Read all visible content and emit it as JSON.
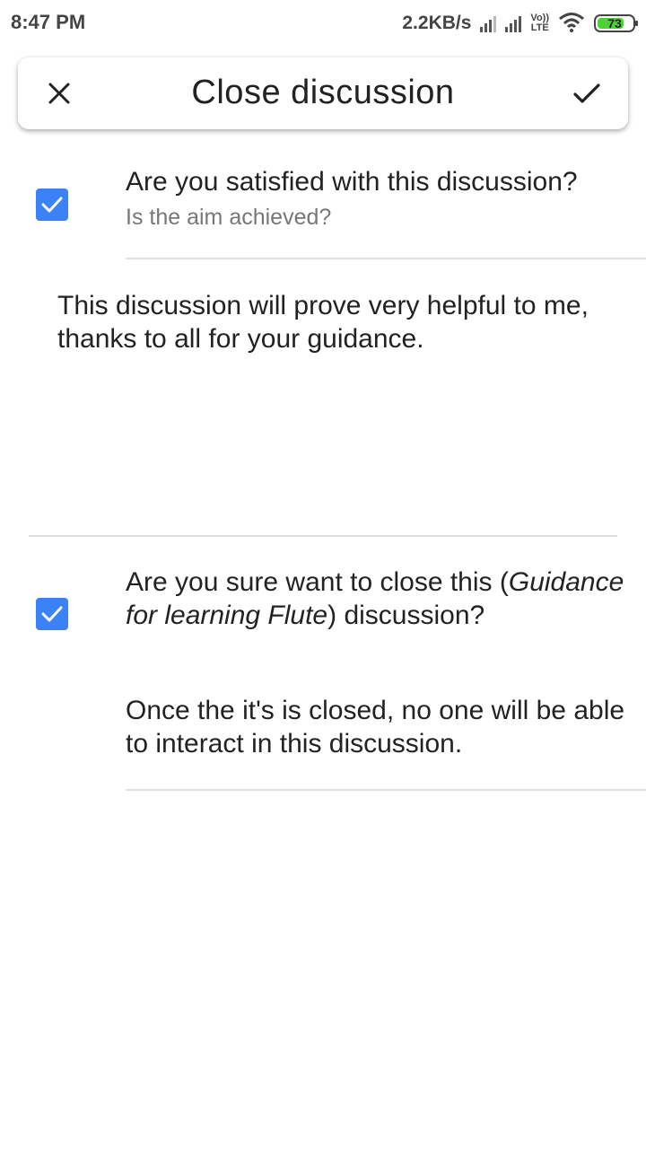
{
  "status_bar": {
    "time": "8:47 PM",
    "network_speed": "2.2KB/s",
    "volte_top": "Vo))",
    "volte_bottom": "LTE",
    "battery": "73"
  },
  "app_bar": {
    "title": "Close discussion",
    "close_icon": "close-icon",
    "confirm_icon": "check-icon"
  },
  "satisfaction": {
    "checked": true,
    "question": "Are you satisfied with this discussion?",
    "hint": "Is the aim achieved?"
  },
  "feedback_text": "This discussion will prove very helpful to me, thanks to all for your guidance.",
  "close_confirm": {
    "checked": true,
    "question_prefix": "Are you sure want to close this (",
    "discussion_name": "Guidance for learning Flute",
    "question_suffix": ") discussion?",
    "note": "Once the it's is closed, no one will be able to interact in this discussion."
  },
  "colors": {
    "checkbox": "#3b82f6",
    "battery_fill": "#4cd137"
  }
}
